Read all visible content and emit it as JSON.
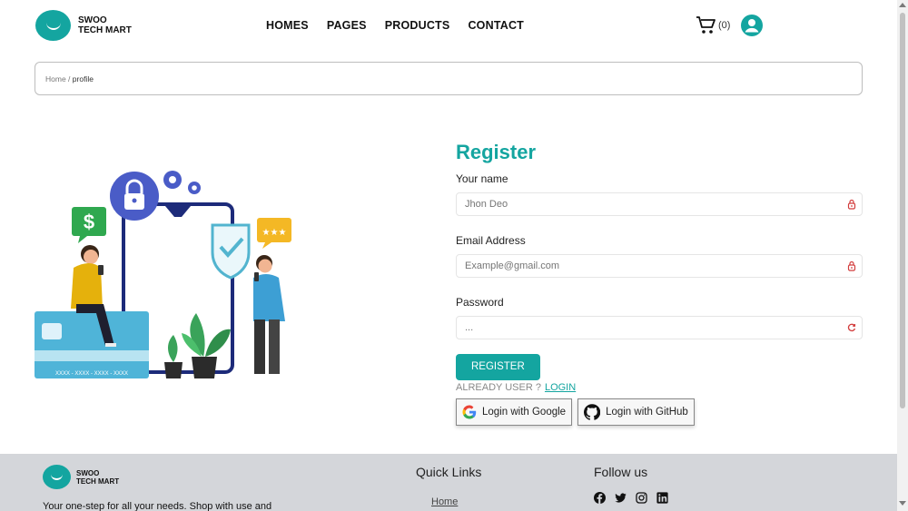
{
  "brand": {
    "line1": "SWOO",
    "line2": "TECH MART",
    "color": "#14a5a0"
  },
  "nav": {
    "items": [
      "HOMES",
      "PAGES",
      "PRODUCTS",
      "CONTACT"
    ]
  },
  "cart": {
    "icon": "cart-icon",
    "count": "(0)"
  },
  "user": {
    "icon": "user-circle-icon"
  },
  "breadcrumb": {
    "home": "Home",
    "separator": " / ",
    "current": "profile"
  },
  "illustration": {
    "card_number": "XXXX - XXXX - XXXX - XXXX",
    "icons": [
      "dollar-bubble-icon",
      "lock-icon",
      "gear-icon",
      "shield-check-icon",
      "stars-bubble-icon",
      "plant-icon"
    ]
  },
  "form": {
    "title": "Register",
    "name_label": "Your name",
    "name_placeholder": "Jhon Deo",
    "email_label": "Email Address",
    "email_placeholder": "Example@gmail.com",
    "password_label": "Password",
    "password_placeholder": "...",
    "register_button": "REGISTER",
    "already_text": "ALREADY USER ?",
    "login_link": "LOGIN",
    "google_button": "Login with Google",
    "github_button": "Login with GitHub"
  },
  "footer": {
    "line1": "SWOO",
    "line2": "TECH MART",
    "tagline": "Your one-step for all your needs. Shop with use and",
    "quick_links_title": "Quick Links",
    "quick_links": [
      "Home"
    ],
    "follow_title": "Follow us",
    "social_icons": [
      "facebook-icon",
      "twitter-icon",
      "instagram-icon",
      "linkedin-icon"
    ]
  }
}
